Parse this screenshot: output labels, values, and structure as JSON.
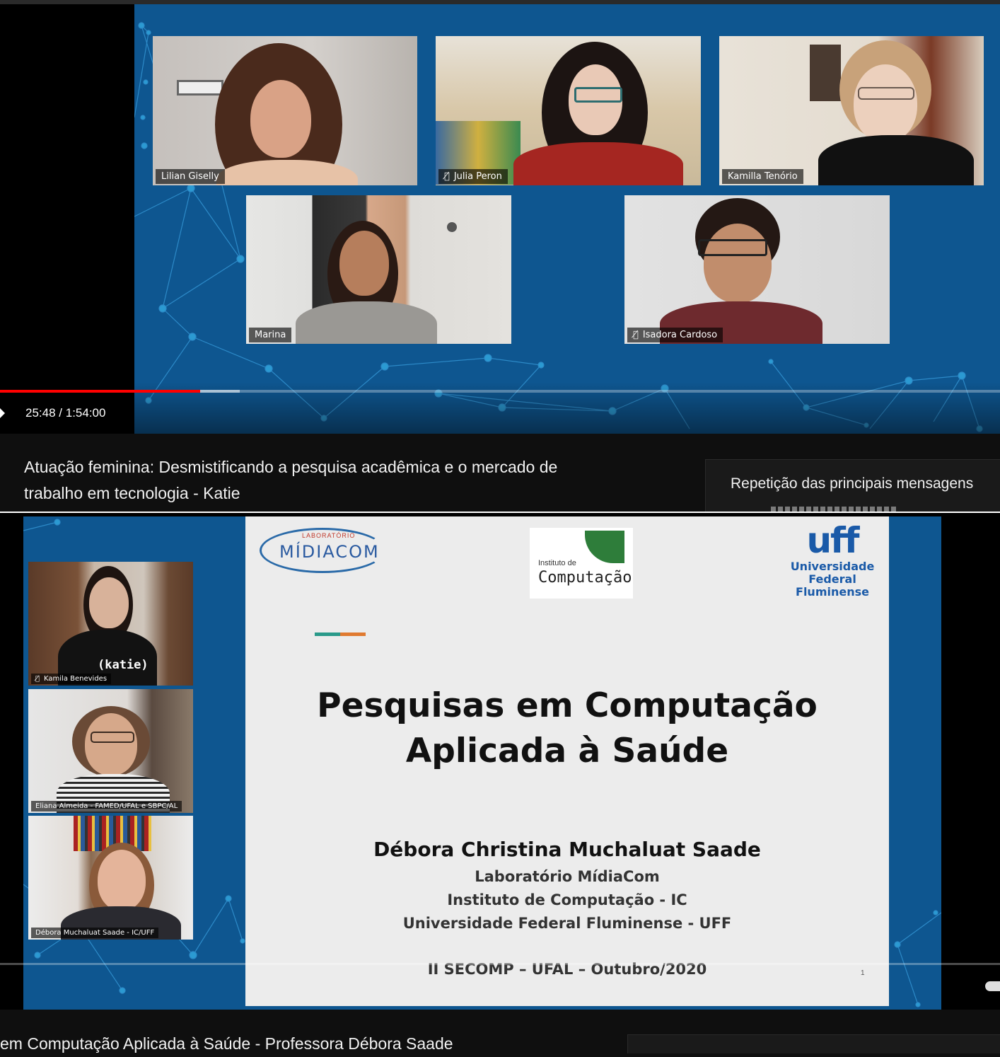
{
  "player1": {
    "time_current": "25:48",
    "time_total": "1:54:00",
    "progress_fraction": 0.2,
    "participants": [
      {
        "name": "Lilian Giselly",
        "muted": false
      },
      {
        "name": "Julia Peron",
        "muted": true
      },
      {
        "name": "Kamilla Tenório",
        "muted": false
      },
      {
        "name": "Marina",
        "muted": false
      },
      {
        "name": "Isadora Cardoso",
        "muted": true
      }
    ],
    "title_line1": "Atuação feminina: Desmistificando a pesquisa acadêmica e o mercado de",
    "title_line2": "trabalho em tecnologia - Katie",
    "next_card_title": "Repetição das principais mensagens"
  },
  "player2": {
    "participants": [
      {
        "name": "Kamila Benevides",
        "muted": true
      },
      {
        "name": "Eliana Almeida - FAMED/UFAL e SBPC/AL",
        "muted": false
      },
      {
        "name": "Débora Muchaluat Saade - IC/UFF",
        "muted": false
      }
    ],
    "shirt_text": "(katie)",
    "slide": {
      "logo_lab_small": "LABORATÓRIO",
      "logo_lab": "MÍDIACOM",
      "logo_ic_small": "Instituto de",
      "logo_ic": "Computação",
      "logo_uff_mark": "uff",
      "logo_uff_line1": "Universidade",
      "logo_uff_line2": "Federal",
      "logo_uff_line3": "Fluminense",
      "title_line1": "Pesquisas em Computação",
      "title_line2": "Aplicada à Saúde",
      "author": "Débora Christina Muchaluat Saade",
      "affiliation1": "Laboratório MídiaCom",
      "affiliation2": "Instituto de Computação - IC",
      "affiliation3": "Universidade Federal Fluminense - UFF",
      "event": "II SECOMP – UFAL – Outubro/2020",
      "page_number": "1"
    },
    "title": "em Computação Aplicada à Saúde - Professora Débora Saade"
  },
  "colors": {
    "network_bg": "#0e5690",
    "progress_red": "#ff0000",
    "page_bg": "#0f0f0f"
  }
}
